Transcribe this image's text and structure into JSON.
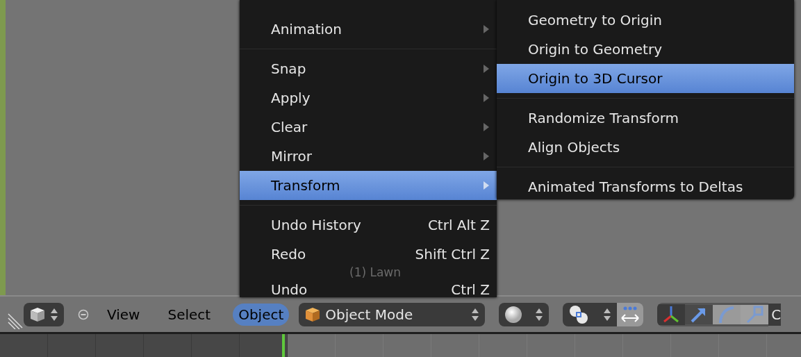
{
  "viewport": {
    "object_label": "(1) Lawn"
  },
  "menu": {
    "items": [
      {
        "kind": "submenu",
        "label": "Animation",
        "selected": false
      },
      {
        "kind": "separator"
      },
      {
        "kind": "submenu",
        "label": "Snap",
        "selected": false
      },
      {
        "kind": "submenu",
        "label": "Apply",
        "selected": false
      },
      {
        "kind": "submenu",
        "label": "Clear",
        "selected": false
      },
      {
        "kind": "submenu",
        "label": "Mirror",
        "selected": false
      },
      {
        "kind": "submenu",
        "label": "Transform",
        "selected": true
      },
      {
        "kind": "separator"
      },
      {
        "kind": "action",
        "label": "Undo History",
        "shortcut": "Ctrl Alt Z",
        "selected": false
      },
      {
        "kind": "action",
        "label": "Redo",
        "shortcut": "Shift Ctrl Z",
        "selected": false
      },
      {
        "kind": "action",
        "label": "Undo",
        "shortcut": "Ctrl Z",
        "selected": false
      }
    ]
  },
  "submenu": {
    "items": [
      {
        "kind": "action",
        "label": "Geometry to Origin",
        "selected": false
      },
      {
        "kind": "action",
        "label": "Origin to Geometry",
        "selected": false
      },
      {
        "kind": "action",
        "label": "Origin to 3D Cursor",
        "selected": true
      },
      {
        "kind": "separator"
      },
      {
        "kind": "action",
        "label": "Randomize Transform",
        "selected": false
      },
      {
        "kind": "action",
        "label": "Align Objects",
        "selected": false
      },
      {
        "kind": "separator"
      },
      {
        "kind": "action",
        "label": "Animated Transforms to Deltas",
        "selected": false
      }
    ]
  },
  "header": {
    "menus": [
      {
        "label": "View",
        "selected": false
      },
      {
        "label": "Select",
        "selected": false
      },
      {
        "label": "Object",
        "selected": true
      }
    ],
    "mode_dropdown": "Object Mode",
    "cut_label": "C"
  }
}
